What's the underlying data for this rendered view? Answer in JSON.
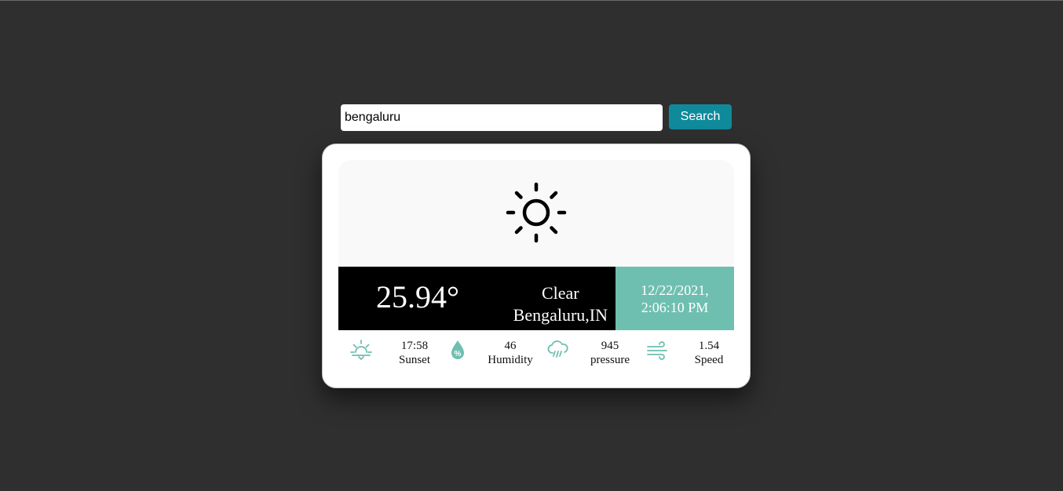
{
  "search": {
    "value": "bengaluru",
    "button_label": "Search"
  },
  "weather": {
    "icon": "sun-icon",
    "temperature": "25.94°",
    "condition": "Clear",
    "location": "Bengaluru,IN",
    "date": "12/22/2021,",
    "time": "2:06:10 PM"
  },
  "stats": [
    {
      "icon": "sunset-icon",
      "value": "17:58",
      "label": "Sunset"
    },
    {
      "icon": "humidity-icon",
      "value": "46",
      "label": "Humidity"
    },
    {
      "icon": "rain-cloud-icon",
      "value": "945",
      "label": "pressure"
    },
    {
      "icon": "wind-icon",
      "value": "1.54",
      "label": "Speed"
    }
  ],
  "colors": {
    "background": "#2f2f2f",
    "accent_teal": "#6fbfb0",
    "button": "#0f8a9b"
  }
}
